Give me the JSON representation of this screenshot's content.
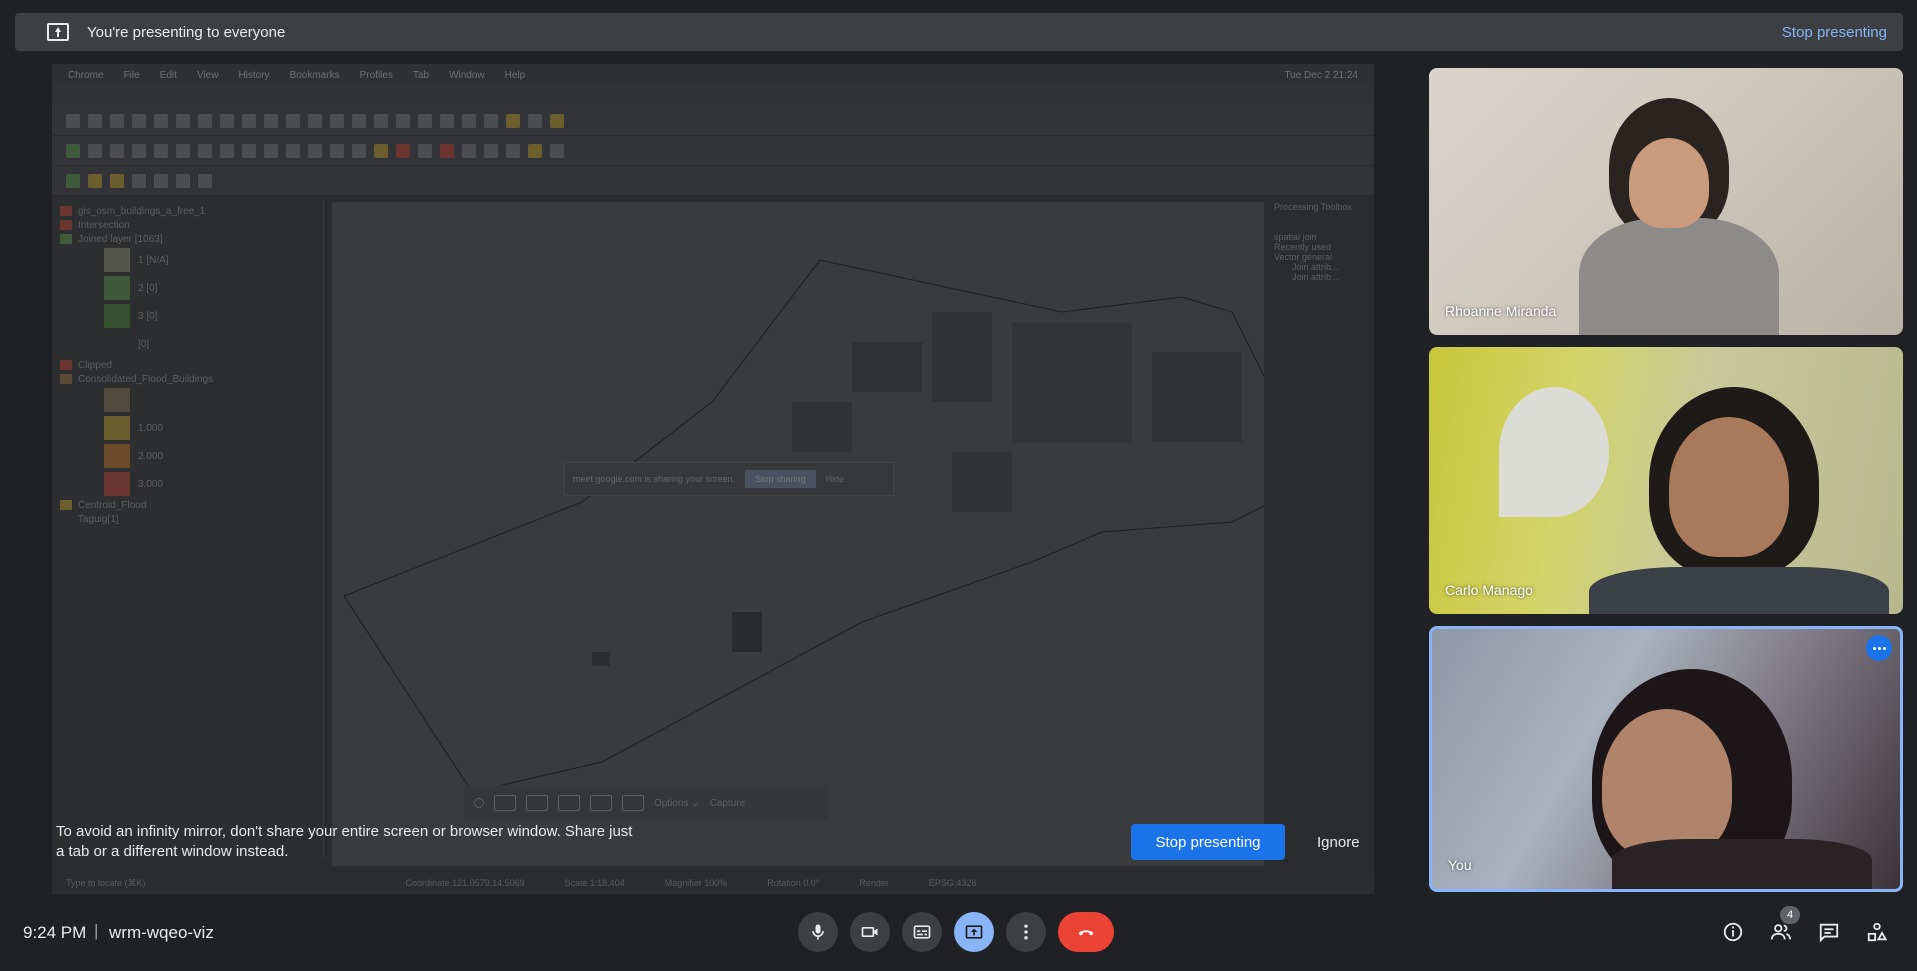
{
  "presenting_bar": {
    "message": "You're presenting to everyone",
    "stop_label": "Stop presenting"
  },
  "shared_screen": {
    "menu_items": [
      "Chrome",
      "File",
      "Edit",
      "View",
      "History",
      "Bookmarks",
      "Profiles",
      "Tab",
      "Window",
      "Help"
    ],
    "clock": "Tue Dec 2  21:24",
    "layers": [
      "gis_osm_buildings_a_free_1",
      "Intersection",
      "Joined layer [1063]",
      "1 [N/A]",
      "2 [0]",
      "3 [0]",
      "[0]",
      "Clipped",
      "Consolidated_Flood_Buildings",
      "1.000",
      "2.000",
      "3.000",
      "Centroid_Flood",
      "Taguig[1]"
    ],
    "right_panel": [
      "Processing Toolbox",
      "spatial join",
      "Recently used",
      "Vector general",
      "Join attrib...",
      "Join attrib..."
    ],
    "status": [
      "Type to locate (⌘K)",
      "Coordinate  121.0579,14.5069",
      "Scale  1:18,404",
      "Magnifier  100%",
      "Rotation  0.0°",
      "Render",
      "EPSG:4326"
    ],
    "mini_dialog": {
      "text": "meet.google.com is sharing your screen.",
      "stop": "Stop sharing",
      "hide": "Hide"
    },
    "capture_bar": {
      "options": "Options ⌄",
      "capture": "Capture"
    }
  },
  "infinity_warning": {
    "text": "To avoid an infinity mirror, don't share your entire screen or browser window. Share just a tab or a different window instead.",
    "stop_label": "Stop presenting",
    "ignore_label": "Ignore"
  },
  "participants": [
    {
      "name": "Rhoanne Miranda"
    },
    {
      "name": "Carlo Manago"
    },
    {
      "name": "You"
    }
  ],
  "meeting": {
    "time": "9:24 PM",
    "separator": "|",
    "code": "wrm-wqeo-viz",
    "participant_count": "4"
  },
  "colors": {
    "accent": "#8ab4f8",
    "primary_button": "#1a73e8",
    "end_call": "#ea4335",
    "background": "#202124"
  },
  "icons": [
    "present-to-all-icon",
    "mic-icon",
    "camera-icon",
    "captions-icon",
    "present-icon",
    "more-vert-icon",
    "end-call-icon",
    "info-icon",
    "people-icon",
    "chat-icon",
    "activities-icon",
    "more-horiz-icon"
  ]
}
